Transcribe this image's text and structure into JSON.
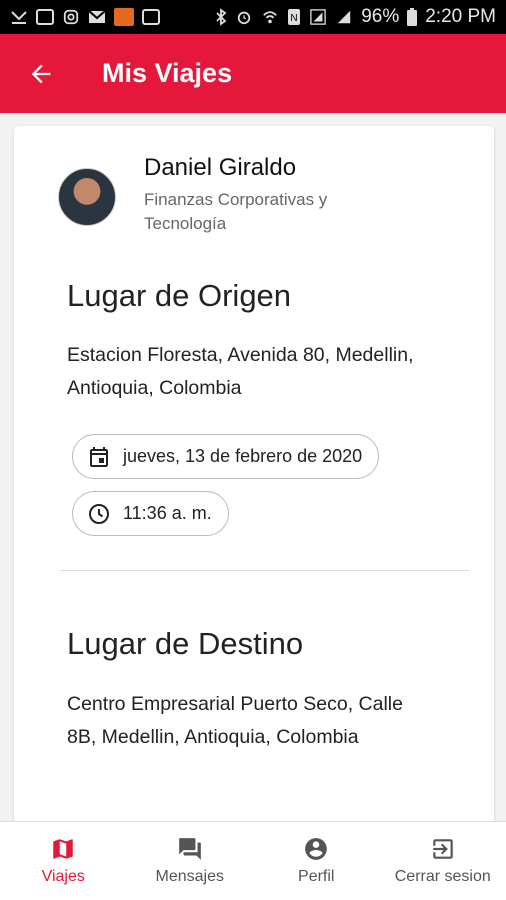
{
  "status_bar": {
    "battery": "96%",
    "time": "2:20 PM"
  },
  "header": {
    "title": "Mis Viajes"
  },
  "profile": {
    "name": "Daniel Giraldo",
    "department": "Finanzas Corporativas y Tecnología"
  },
  "origin": {
    "title": "Lugar de Origen",
    "address": "Estacion Floresta, Avenida 80, Medellin, Antioquia, Colombia",
    "date": "jueves, 13 de febrero de 2020",
    "time": "11:36 a. m."
  },
  "destination": {
    "title": "Lugar de Destino",
    "address": "Centro Empresarial Puerto Seco, Calle 8B, Medellin, Antioquia, Colombia"
  },
  "nav": {
    "items": [
      {
        "label": "Viajes",
        "icon": "map-icon"
      },
      {
        "label": "Mensajes",
        "icon": "messages-icon"
      },
      {
        "label": "Perfil",
        "icon": "profile-icon"
      },
      {
        "label": "Cerrar sesion",
        "icon": "logout-icon"
      }
    ]
  },
  "colors": {
    "primary": "#e5173a",
    "status_bar": "#000000"
  }
}
